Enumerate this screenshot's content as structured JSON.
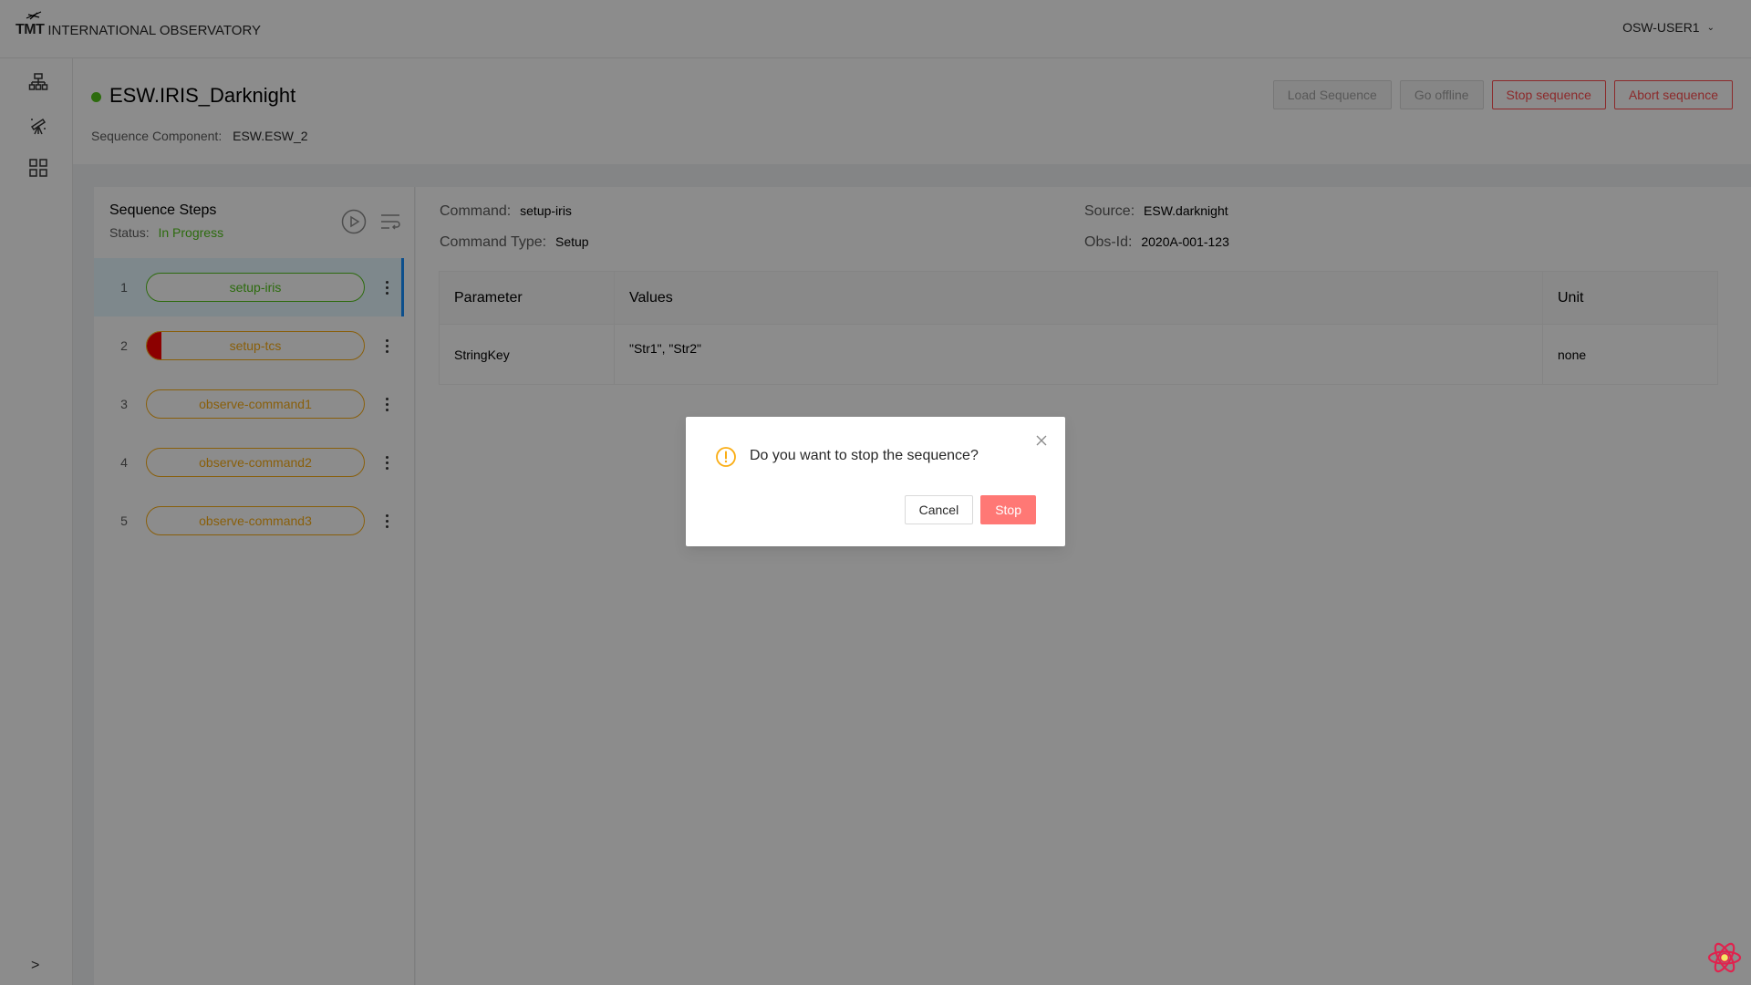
{
  "header": {
    "logo_mark": "TMT",
    "logo_text": "INTERNATIONAL OBSERVATORY",
    "user": "OSW-USER1"
  },
  "sidenav": {
    "items": [
      "infrastructure-icon",
      "telescope-icon",
      "apps-grid-icon"
    ],
    "expand": ">"
  },
  "page": {
    "title": "ESW.IRIS_Darknight",
    "status_color": "#52c41a",
    "seq_component_label": "Sequence Component:",
    "seq_component_value": "ESW.ESW_2",
    "buttons": {
      "load": "Load Sequence",
      "offline": "Go offline",
      "stop": "Stop sequence",
      "abort": "Abort sequence"
    }
  },
  "steps": {
    "title": "Sequence Steps",
    "status_label": "Status:",
    "status_value": "In Progress",
    "items": [
      {
        "num": "1",
        "name": "setup-iris"
      },
      {
        "num": "2",
        "name": "setup-tcs"
      },
      {
        "num": "3",
        "name": "observe-command1"
      },
      {
        "num": "4",
        "name": "observe-command2"
      },
      {
        "num": "5",
        "name": "observe-command3"
      }
    ]
  },
  "details": {
    "command_label": "Command:",
    "command_value": "setup-iris",
    "type_label": "Command Type:",
    "type_value": "Setup",
    "source_label": "Source:",
    "source_value": "ESW.darknight",
    "obsid_label": "Obs-Id:",
    "obsid_value": "2020A-001-123",
    "table": {
      "headers": [
        "Parameter",
        "Values",
        "Unit"
      ],
      "rows": [
        [
          "StringKey",
          "\"Str1\", \"Str2\"",
          "none"
        ]
      ]
    }
  },
  "modal": {
    "message": "Do you want to stop the sequence?",
    "cancel": "Cancel",
    "confirm": "Stop"
  },
  "colors": {
    "success": "#52c41a",
    "warning": "#faad14",
    "danger": "#ff4d4f",
    "primary": "#1890ff"
  }
}
